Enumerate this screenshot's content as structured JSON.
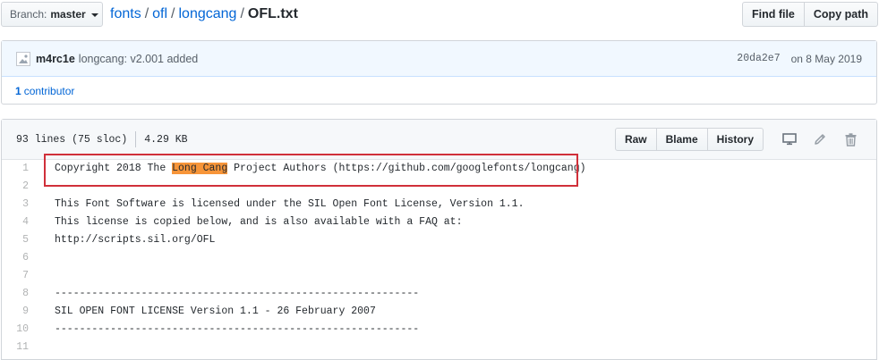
{
  "branch": {
    "label": "Branch:",
    "value": "master"
  },
  "breadcrumb": {
    "repo": "fonts",
    "dir1": "ofl",
    "dir2": "longcang",
    "file": "OFL.txt",
    "sep": "/"
  },
  "top_buttons": {
    "find_file": "Find file",
    "copy_path": "Copy path"
  },
  "commit": {
    "author": "m4rc1e",
    "message": "longcang: v2.001 added",
    "sha": "20da2e7",
    "date": "on 8 May 2019"
  },
  "contributors": {
    "count": "1",
    "label": "contributor"
  },
  "file_info": {
    "lines": "93 lines (75 sloc)",
    "size": "4.29 KB"
  },
  "file_buttons": {
    "raw": "Raw",
    "blame": "Blame",
    "history": "History"
  },
  "icons": {
    "desktop": "desktop-icon",
    "edit": "pencil-icon",
    "delete": "trash-icon",
    "avatar": "avatar-icon"
  },
  "colors": {
    "link": "#0366d6",
    "highlight": "#f79539",
    "annotation_box": "#d0303a"
  },
  "code_lines": [
    {
      "n": "1",
      "pre": "Copyright 2018 The ",
      "hl": "Long Cang",
      "post": " Project Authors (https://github.com/googlefonts/longcang)"
    },
    {
      "n": "2",
      "pre": "",
      "hl": "",
      "post": ""
    },
    {
      "n": "3",
      "pre": "This Font Software is licensed under the SIL Open Font License, Version 1.1.",
      "hl": "",
      "post": ""
    },
    {
      "n": "4",
      "pre": "This license is copied below, and is also available with a FAQ at:",
      "hl": "",
      "post": ""
    },
    {
      "n": "5",
      "pre": "http://scripts.sil.org/OFL",
      "hl": "",
      "post": ""
    },
    {
      "n": "6",
      "pre": "",
      "hl": "",
      "post": ""
    },
    {
      "n": "7",
      "pre": "",
      "hl": "",
      "post": ""
    },
    {
      "n": "8",
      "pre": "-----------------------------------------------------------",
      "hl": "",
      "post": ""
    },
    {
      "n": "9",
      "pre": "SIL OPEN FONT LICENSE Version 1.1 - 26 February 2007",
      "hl": "",
      "post": ""
    },
    {
      "n": "10",
      "pre": "-----------------------------------------------------------",
      "hl": "",
      "post": ""
    },
    {
      "n": "11",
      "pre": "",
      "hl": "",
      "post": ""
    }
  ]
}
